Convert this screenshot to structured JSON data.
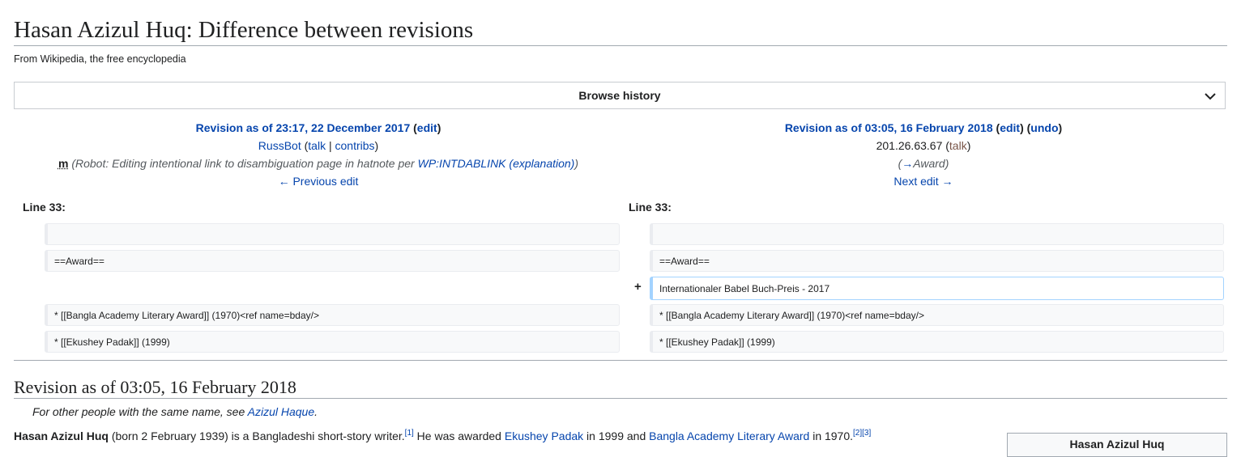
{
  "page": {
    "title": "Hasan Azizul Huq: Difference between revisions",
    "tagline": "From Wikipedia, the free encyclopedia",
    "browse_label": "Browse history"
  },
  "left": {
    "revision": "Revision as of 23:17, 22 December 2017",
    "edit": "edit",
    "user": "RussBot",
    "talk": "talk",
    "contribs": "contribs",
    "minor": "m",
    "summary": "(Robot: Editing intentional link to disambiguation page in hatnote per ",
    "summary_link": "WP:INTDABLINK",
    "summary_expl": "(explanation)",
    "nav": "← Previous edit",
    "line_label": "Line 33:"
  },
  "right": {
    "revision": "Revision as of 03:05, 16 February 2018",
    "edit": "edit",
    "undo": "undo",
    "user": "201.26.63.67",
    "talk": "talk",
    "summary_arrow": "→",
    "summary_section": "Award",
    "nav": "Next edit →",
    "line_label": "Line 33:"
  },
  "diff": {
    "left_rows": [
      "",
      "==Award==",
      "* [[Bangla Academy Literary Award]] (1970)<ref name=bday/>",
      "* [[Ekushey Padak]] (1999)"
    ],
    "right_rows": [
      "",
      "==Award==",
      "Internationaler Babel Buch-Preis - 2017",
      "* [[Bangla Academy Literary Award]] (1970)<ref name=bday/>",
      "* [[Ekushey Padak]] (1999)"
    ],
    "added_marker": "+"
  },
  "article": {
    "revision_title": "Revision as of 03:05, 16 February 2018",
    "hatnote_prefix": "For other people with the same name, see ",
    "hatnote_link": "Azizul Haque",
    "hatnote_suffix": ".",
    "lead_name": "Hasan Azizul Huq",
    "lead_text1": " (born 2 February 1939) is a Bangladeshi short-story writer.",
    "ref1": "[1]",
    "lead_text2": " He was awarded ",
    "link1": "Ekushey Padak",
    "lead_text3": " in 1999 and ",
    "link2": "Bangla Academy Literary Award",
    "lead_text4": " in 1970.",
    "ref2": "[2]",
    "ref3": "[3]",
    "infobox_title": "Hasan Azizul Huq"
  },
  "colors": {
    "link": "#0645ad",
    "border": "#a2a9b1",
    "added": "#a3d3ff",
    "context_bg": "#f8f9fa"
  }
}
